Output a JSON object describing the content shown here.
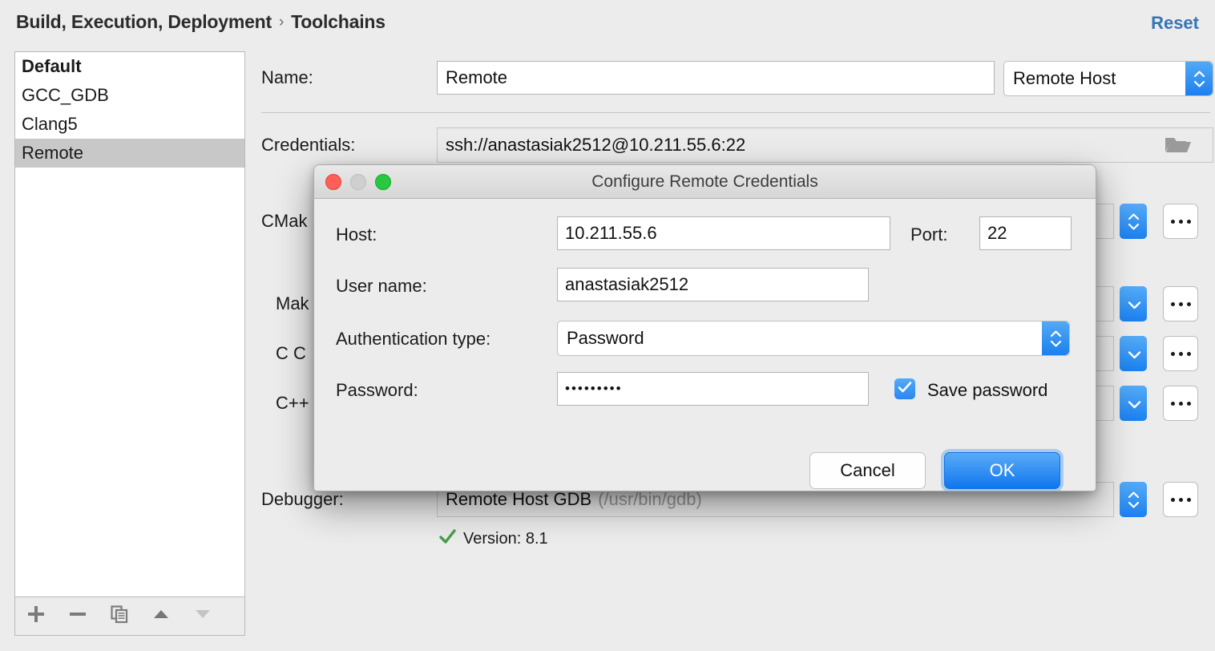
{
  "header": {
    "breadcrumb_root": "Build, Execution, Deployment",
    "breadcrumb_separator": "›",
    "breadcrumb_leaf": "Toolchains",
    "reset_label": "Reset",
    "accent_color": "#3574b6"
  },
  "toolchain_list": {
    "items": [
      {
        "label": "Default",
        "bold": true,
        "selected": false
      },
      {
        "label": "GCC_GDB",
        "bold": false,
        "selected": false
      },
      {
        "label": "Clang5",
        "bold": false,
        "selected": false
      },
      {
        "label": "Remote",
        "bold": false,
        "selected": true
      }
    ],
    "toolbar": [
      {
        "icon": "plus-icon",
        "name": "add-toolchain-button"
      },
      {
        "icon": "minus-icon",
        "name": "remove-toolchain-button"
      },
      {
        "icon": "copy-icon",
        "name": "copy-toolchain-button"
      },
      {
        "icon": "arrow-up-icon",
        "name": "move-up-button"
      },
      {
        "icon": "arrow-down-icon",
        "name": "move-down-button"
      }
    ]
  },
  "form": {
    "name_label": "Name:",
    "name_value": "Remote",
    "type_value": "Remote Host",
    "credentials_label": "Credentials:",
    "credentials_value": "ssh://anastasiak2512@10.211.55.6:22",
    "credentials_browse_icon": "folder-icon",
    "cmake_label": "CMak",
    "make_label": "Mak",
    "c_compiler_label": "C C",
    "cxx_compiler_label": "C++",
    "debugger_label": "Debugger:",
    "debugger_value": "Remote Host GDB",
    "debugger_path": "(/usr/bin/gdb)",
    "version_text": "Version: 8.1",
    "version_status_icon": "check-icon",
    "version_status_color": "#4a9c4a",
    "ellipsis_label": "..."
  },
  "dialog": {
    "title": "Configure Remote Credentials",
    "traffic_lights": [
      {
        "name": "close-window-button",
        "color": "#ff5f57"
      },
      {
        "name": "minimize-window-button",
        "color": "#cfcfcf"
      },
      {
        "name": "maximize-window-button",
        "color": "#28c840"
      }
    ],
    "host_label": "Host:",
    "host_value": "10.211.55.6",
    "port_label": "Port:",
    "port_value": "22",
    "username_label": "User name:",
    "username_value": "anastasiak2512",
    "auth_type_label": "Authentication type:",
    "auth_type_value": "Password",
    "password_label": "Password:",
    "password_value": "•••••••••",
    "save_password_label": "Save password",
    "save_password_checked": true,
    "cancel_label": "Cancel",
    "ok_label": "OK"
  }
}
